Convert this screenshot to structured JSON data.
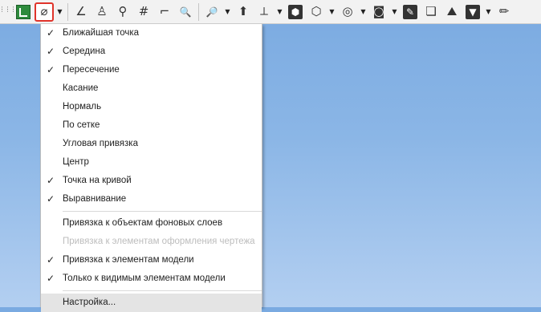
{
  "toolbar": {
    "grip_glyph": "⋮⋮⋮",
    "dropdown_glyph": "▼",
    "buttons": [
      {
        "name": "snap-toggle-icon",
        "glyph": "",
        "kind": "green"
      },
      {
        "name": "snap-settings-icon",
        "glyph": "⌀",
        "kind": "active"
      },
      {
        "name": "angle-snap-icon",
        "glyph": "∠",
        "kind": "plain"
      },
      {
        "name": "person-snap-icon",
        "glyph": "♙",
        "kind": "plain"
      },
      {
        "name": "point-icon",
        "glyph": "⚲",
        "kind": "plain"
      },
      {
        "name": "grid-icon",
        "glyph": "#",
        "kind": "plain"
      },
      {
        "name": "step-icon",
        "glyph": "⌐",
        "kind": "plain"
      },
      {
        "name": "zoom-icon",
        "glyph": "🔍",
        "kind": "plain"
      },
      {
        "name": "zoom-window-icon",
        "glyph": "🔎",
        "kind": "plain"
      },
      {
        "name": "view-orient-icon",
        "glyph": "⬆",
        "kind": "plain"
      },
      {
        "name": "axis-icon",
        "glyph": "⟂",
        "kind": "plain"
      },
      {
        "name": "display-shaded-icon",
        "glyph": "⬢",
        "kind": "dark"
      },
      {
        "name": "display-mode-icon",
        "glyph": "⬡",
        "kind": "plain"
      },
      {
        "name": "visibility-icon",
        "glyph": "◎",
        "kind": "plain"
      },
      {
        "name": "section-icon",
        "glyph": "◙",
        "kind": "plain"
      },
      {
        "name": "filter-tools-icon",
        "glyph": "✎",
        "kind": "dark"
      },
      {
        "name": "layers-icon",
        "glyph": "❏",
        "kind": "plain"
      },
      {
        "name": "scene-icon",
        "glyph": "⛰",
        "kind": "plain"
      },
      {
        "name": "filter-icon",
        "glyph": "▼",
        "kind": "dark"
      },
      {
        "name": "pencil-icon",
        "glyph": "✏",
        "kind": "plain"
      }
    ]
  },
  "menu": {
    "check_glyph": "✓",
    "items": [
      {
        "label": "Ближайшая точка",
        "checked": true
      },
      {
        "label": "Середина",
        "checked": true
      },
      {
        "label": "Пересечение",
        "checked": true
      },
      {
        "label": "Касание",
        "checked": false
      },
      {
        "label": "Нормаль",
        "checked": false
      },
      {
        "label": "По сетке",
        "checked": false
      },
      {
        "label": "Угловая привязка",
        "checked": false
      },
      {
        "label": "Центр",
        "checked": false
      },
      {
        "label": "Точка на кривой",
        "checked": true
      },
      {
        "label": "Выравнивание",
        "checked": true
      },
      {
        "label": "Привязка к объектам фоновых слоев",
        "checked": false
      },
      {
        "label": "Привязка к элементам оформления чертежа",
        "checked": false,
        "disabled": true
      },
      {
        "label": "Привязка к элементам модели",
        "checked": true
      },
      {
        "label": "Только к видимым элементам модели",
        "checked": true
      },
      {
        "label": "Настройка...",
        "checked": false
      }
    ]
  }
}
